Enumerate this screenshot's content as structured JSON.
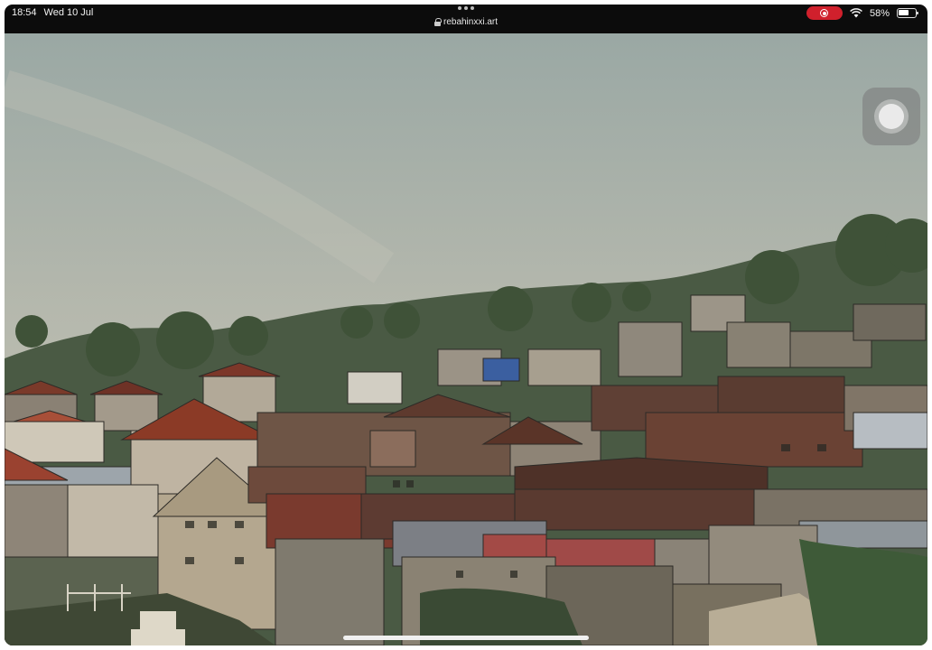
{
  "status_bar": {
    "time": "18:54",
    "date": "Wed 10 Jul",
    "battery": "58%",
    "icons": [
      "screen-record-icon",
      "wifi-icon",
      "battery-icon"
    ]
  },
  "browser": {
    "url": "rebahinxxi.art",
    "icons": [
      "multitask-dots-icon",
      "lock-icon"
    ]
  },
  "colors": {
    "record": "#d0202c",
    "sky_top": "#9aa8a4",
    "sky_bottom": "#c9c8bb"
  }
}
